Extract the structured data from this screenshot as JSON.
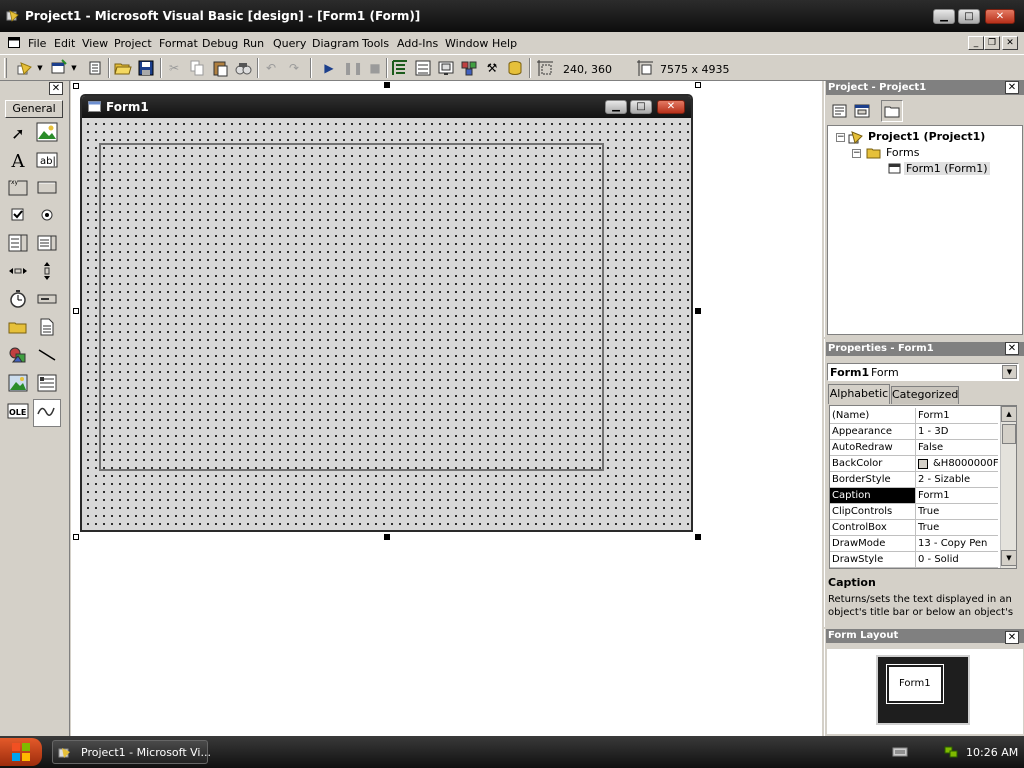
{
  "window": {
    "title": "Project1 - Microsoft Visual Basic [design] - [Form1 (Form)]",
    "minimize_glyph": "▁",
    "maximize_glyph": "□",
    "close_glyph": "✕"
  },
  "menu": {
    "items": [
      "File",
      "Edit",
      "View",
      "Project",
      "Format",
      "Debug",
      "Run",
      "Query",
      "Diagram",
      "Tools",
      "Add-Ins",
      "Window",
      "Help"
    ],
    "mdi_min": "_",
    "mdi_restore": "❐",
    "mdi_close": "✕"
  },
  "toolbar": {
    "position": "240, 360",
    "size": "7575 x 4935"
  },
  "toolbox": {
    "tab": "General",
    "close": "✕"
  },
  "form": {
    "title": "Form1"
  },
  "project_explorer": {
    "title": "Project - Project1",
    "close": "✕",
    "root": "Project1 (Project1)",
    "folder": "Forms",
    "item": "Form1 (Form1)",
    "expand_minus": "−"
  },
  "properties": {
    "title": "Properties - Form1",
    "close": "✕",
    "object_name": "Form1",
    "object_type": "Form",
    "tabs": [
      "Alphabetic",
      "Categorized"
    ],
    "rows": [
      {
        "name": "(Name)",
        "value": "Form1"
      },
      {
        "name": "Appearance",
        "value": "1 - 3D"
      },
      {
        "name": "AutoRedraw",
        "value": "False"
      },
      {
        "name": "BackColor",
        "value": "&H8000000F"
      },
      {
        "name": "BorderStyle",
        "value": "2 - Sizable"
      },
      {
        "name": "Caption",
        "value": "Form1"
      },
      {
        "name": "ClipControls",
        "value": "True"
      },
      {
        "name": "ControlBox",
        "value": "True"
      },
      {
        "name": "DrawMode",
        "value": "13 - Copy Pen"
      },
      {
        "name": "DrawStyle",
        "value": "0 - Solid"
      }
    ],
    "selected": "Caption",
    "desc_title": "Caption",
    "desc_text": "Returns/sets the text displayed in an object's title bar or below an object's"
  },
  "form_layout": {
    "title": "Form Layout",
    "close": "✕",
    "form_label": "Form1"
  },
  "taskbar": {
    "task": "Project1 - Microsoft Vi...",
    "clock": "10:26 AM"
  },
  "colors": {
    "titlebar": "#1a1a1a",
    "selection": "#000000",
    "pane_header": "#808080"
  }
}
